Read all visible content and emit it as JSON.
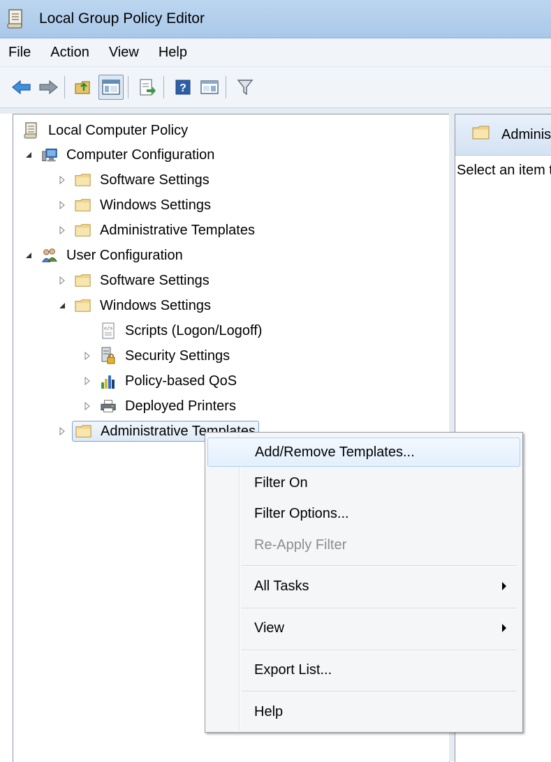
{
  "window": {
    "title": "Local Group Policy Editor"
  },
  "menubar": [
    "File",
    "Action",
    "View",
    "Help"
  ],
  "toolbar": {
    "icons": [
      "back-arrow-icon",
      "forward-arrow-icon",
      "up-folder-icon",
      "show-hide-console-tree-icon",
      "export-list-icon",
      "help-icon",
      "show-hide-action-pane-icon",
      "filter-icon"
    ]
  },
  "tree": {
    "root": "Local Computer Policy",
    "computer_config": "Computer Configuration",
    "cc_software": "Software Settings",
    "cc_windows": "Windows Settings",
    "cc_admin": "Administrative Templates",
    "user_config": "User Configuration",
    "uc_software": "Software Settings",
    "uc_windows": "Windows Settings",
    "scripts": "Scripts (Logon/Logoff)",
    "security": "Security Settings",
    "qos": "Policy-based QoS",
    "printers": "Deployed Printers",
    "uc_admin": "Administrative Templates"
  },
  "right_pane": {
    "header": "Administrative Templates",
    "body": "Select an item to view its description."
  },
  "context_menu": {
    "add_remove": "Add/Remove Templates...",
    "filter_on": "Filter On",
    "filter_options": "Filter Options...",
    "reapply": "Re-Apply Filter",
    "all_tasks": "All Tasks",
    "view": "View",
    "export": "Export List...",
    "help": "Help"
  }
}
